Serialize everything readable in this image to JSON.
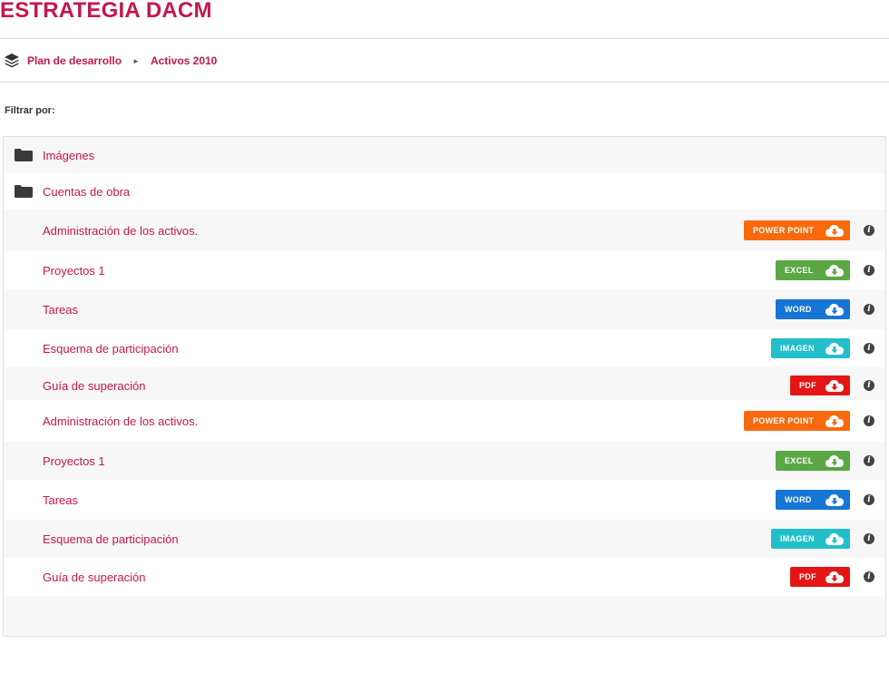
{
  "header": {
    "title": "ESTRATEGIA DACM"
  },
  "breadcrumb": {
    "items": [
      "Plan de desarrollo",
      "Activos 2010"
    ],
    "separator": "►"
  },
  "filter": {
    "label": "Filtrar por:"
  },
  "folders": [
    {
      "label": "Imágenes",
      "icon": "folder-icon"
    },
    {
      "label": "Cuentas de obra",
      "icon": "folder-icon"
    }
  ],
  "files": [
    {
      "label": "Administración de los activos.",
      "type": "POWER POINT",
      "color": "#f96a0e"
    },
    {
      "label": "Proyectos 1",
      "type": "EXCEL",
      "color": "#5aa743"
    },
    {
      "label": "Tareas",
      "type": "WORD",
      "color": "#1775d6"
    },
    {
      "label": "Esquema de participación",
      "type": "IMAGEN",
      "color": "#22bfca"
    },
    {
      "label": "Guía de superación",
      "type": "PDF",
      "color": "#e51515"
    },
    {
      "label": "Administración de los activos.",
      "type": "POWER POINT",
      "color": "#f96a0e"
    },
    {
      "label": "Proyectos 1",
      "type": "EXCEL",
      "color": "#5aa743"
    },
    {
      "label": "Tareas",
      "type": "WORD",
      "color": "#1775d6"
    },
    {
      "label": "Esquema de participación",
      "type": "IMAGEN",
      "color": "#22bfca"
    },
    {
      "label": "Guía de superación",
      "type": "PDF",
      "color": "#e51515"
    }
  ],
  "icons": {
    "download": "cloud-download-icon",
    "info": "info-icon",
    "info_glyph": "i",
    "breadcrumb": "layers-icon"
  },
  "colors": {
    "accent": "#c4174a"
  }
}
